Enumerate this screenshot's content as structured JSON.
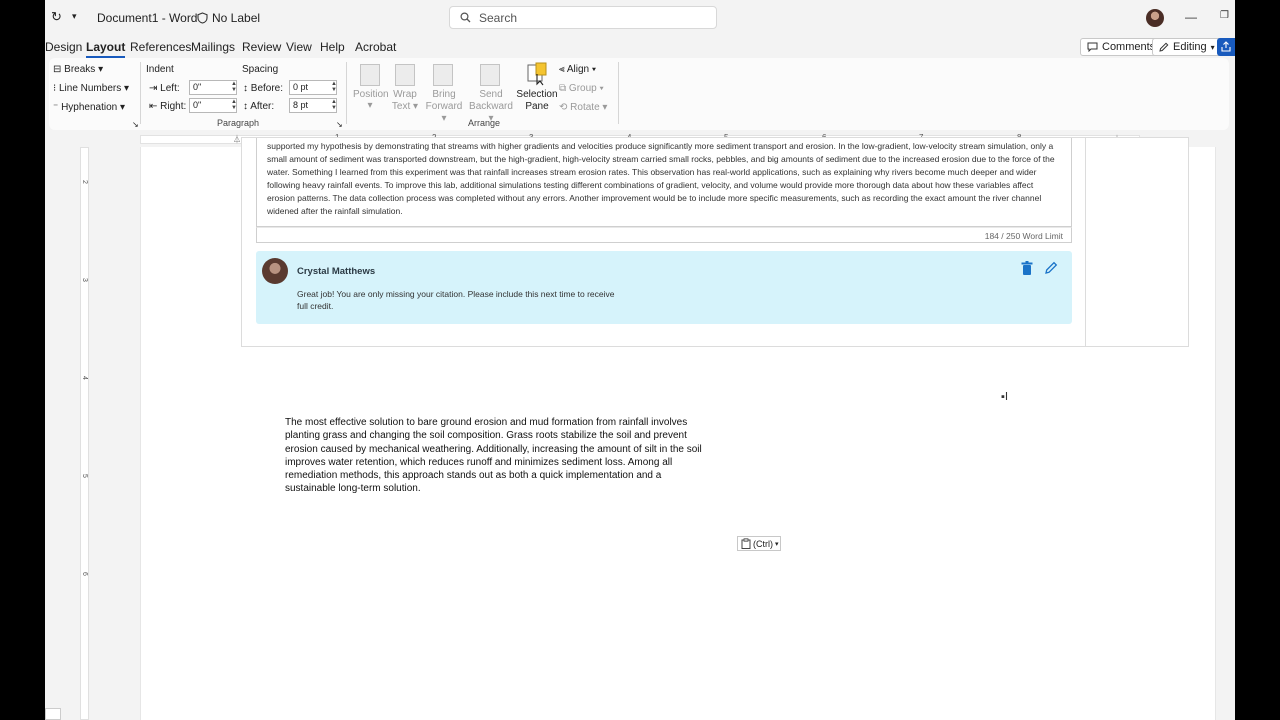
{
  "titlebar": {
    "doc_title": "Document1 - Word",
    "label_status": "No Label",
    "search_placeholder": "Search"
  },
  "tabs": [
    "Design",
    "Layout",
    "References",
    "Mailings",
    "Review",
    "View",
    "Help",
    "Acrobat"
  ],
  "active_tab": "Layout",
  "top_buttons": {
    "comments": "Comments",
    "editing": "Editing"
  },
  "ribbon": {
    "page_setup": {
      "breaks": "Breaks",
      "line_numbers": "Line Numbers",
      "hyphenation": "Hyphenation"
    },
    "paragraph": {
      "group_label": "Paragraph",
      "indent_header": "Indent",
      "spacing_header": "Spacing",
      "left_label": "Left:",
      "left_value": "0\"",
      "right_label": "Right:",
      "right_value": "0\"",
      "before_label": "Before:",
      "before_value": "0 pt",
      "after_label": "After:",
      "after_value": "8 pt"
    },
    "arrange": {
      "group_label": "Arrange",
      "position": "Position",
      "wrap_text_1": "Wrap",
      "wrap_text_2": "Text",
      "bring_forward_1": "Bring",
      "bring_forward_2": "Forward",
      "send_backward_1": "Send",
      "send_backward_2": "Backward",
      "selection_pane_1": "Selection",
      "selection_pane_2": "Pane",
      "align": "Align",
      "group": "Group",
      "rotate": "Rotate"
    }
  },
  "ruler_numbers": [
    "1",
    "2",
    "3",
    "4",
    "5",
    "6",
    "7",
    "8"
  ],
  "vruler_numbers": [
    "2",
    "3",
    "4",
    "5",
    "6"
  ],
  "embedded_response": {
    "essay_text": "supported my hypothesis by demonstrating that streams with higher gradients and velocities produce significantly more sediment transport and erosion. In the low-gradient, low-velocity stream simulation, only a small amount of sediment was transported downstream, but the high-gradient, high-velocity stream carried small rocks, pebbles, and big amounts of sediment due to the increased erosion due to the force of the water. Something I learned from this experiment was that rainfall increases stream erosion rates. This observation has real-world applications, such as explaining why rivers become much deeper and wider following heavy rainfall events. To improve this lab, additional simulations testing different combinations of gradient, velocity, and volume would provide more thorough data about how these variables affect erosion patterns. The data collection process was completed without any errors. Another improvement would be to include more specific measurements, such as recording the exact amount the river channel widened after the rainfall simulation.",
    "word_count": "184 / 250 Word Limit",
    "feedback_author": "Crystal Matthews",
    "feedback_text": "Great job! You are only missing your citation. Please include this next time to receive full credit."
  },
  "document": {
    "paragraph": "The most effective solution to bare ground erosion and mud formation from rainfall involves planting grass and changing the soil composition. Grass roots stabilize the soil and prevent erosion caused by mechanical weathering. Additionally, increasing the amount of silt in the soil improves water retention, which reduces runoff and minimizes sediment loss. Among all remediation methods, this approach stands out as both a quick implementation and a sustainable long-term solution.",
    "paste_options": "(Ctrl)"
  },
  "colors": {
    "accent": "#185abd",
    "feedback_bg": "#d6f3fb",
    "icon_blue": "#1a73c8"
  }
}
